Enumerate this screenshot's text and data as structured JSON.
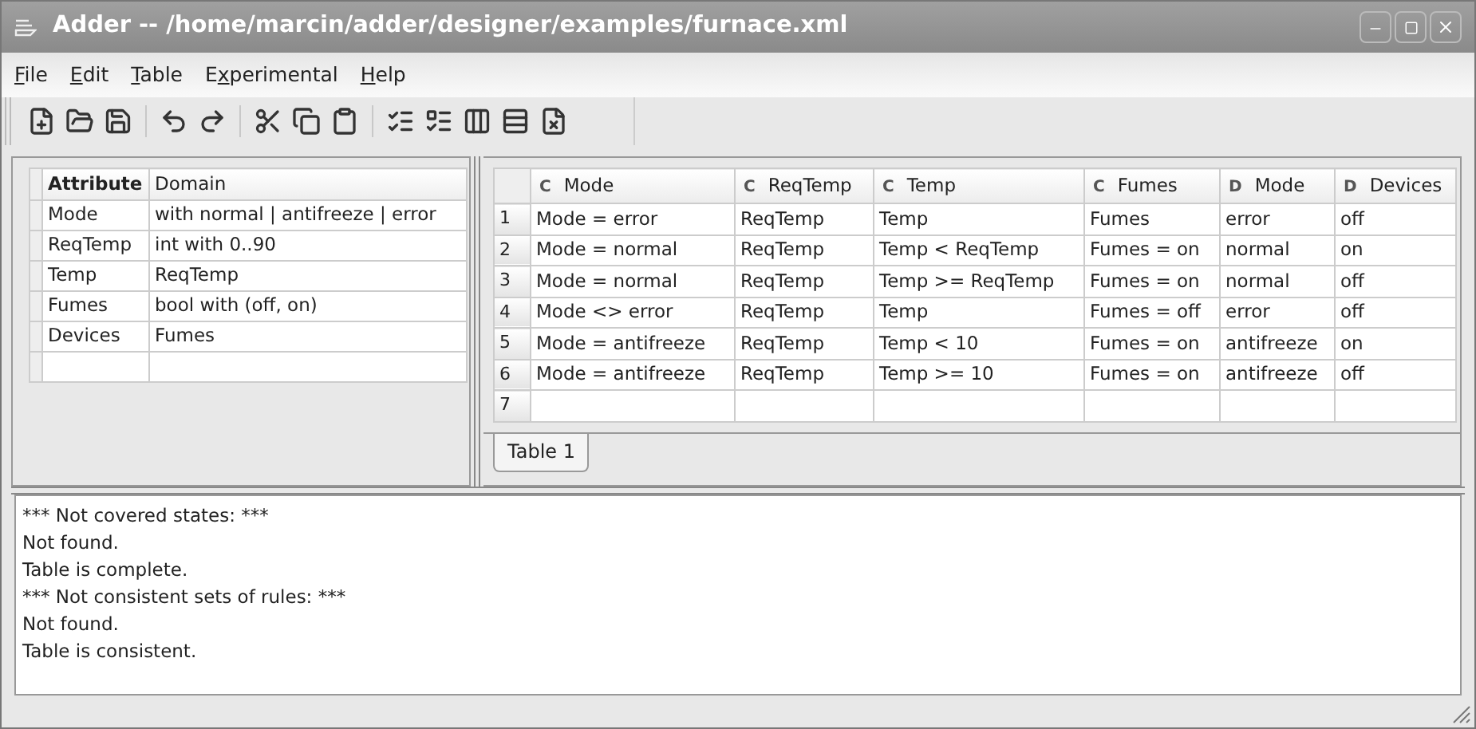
{
  "window": {
    "title": "Adder -- /home/marcin/adder/designer/examples/furnace.xml"
  },
  "menu": [
    {
      "key": "F",
      "post": "ile"
    },
    {
      "key": "E",
      "post": "dit"
    },
    {
      "key": "T",
      "post": "able"
    },
    {
      "pre": "E",
      "key": "x",
      "post": "perimental"
    },
    {
      "key": "H",
      "post": "elp"
    }
  ],
  "attributes": {
    "columns": [
      "Attribute",
      "Domain"
    ],
    "rows": [
      {
        "name": "Mode",
        "domain": "with normal | antifreeze | error"
      },
      {
        "name": "ReqTemp",
        "domain": "int with 0..90"
      },
      {
        "name": "Temp",
        "domain": "ReqTemp"
      },
      {
        "name": "Fumes",
        "domain": "bool with (off, on)"
      },
      {
        "name": "Devices",
        "domain": "Fumes"
      }
    ]
  },
  "rules": {
    "columns": [
      {
        "mark": "C",
        "label": "Mode"
      },
      {
        "mark": "C",
        "label": "ReqTemp"
      },
      {
        "mark": "C",
        "label": "Temp"
      },
      {
        "mark": "C",
        "label": "Fumes"
      },
      {
        "mark": "D",
        "label": "Mode"
      },
      {
        "mark": "D",
        "label": "Devices"
      }
    ],
    "rows": [
      {
        "number": "1",
        "cells": [
          "Mode = error",
          "ReqTemp",
          "Temp",
          "Fumes",
          "error",
          "off"
        ]
      },
      {
        "number": "2",
        "cells": [
          "Mode = normal",
          "ReqTemp",
          "Temp < ReqTemp",
          "Fumes = on",
          "normal",
          "on"
        ]
      },
      {
        "number": "3",
        "cells": [
          "Mode = normal",
          "ReqTemp",
          "Temp >= ReqTemp",
          "Fumes = on",
          "normal",
          "off"
        ]
      },
      {
        "number": "4",
        "cells": [
          "Mode <> error",
          "ReqTemp",
          "Temp",
          "Fumes = off",
          "error",
          "off"
        ]
      },
      {
        "number": "5",
        "cells": [
          "Mode = antifreeze",
          "ReqTemp",
          "Temp < 10",
          "Fumes = on",
          "antifreeze",
          "on"
        ]
      },
      {
        "number": "6",
        "cells": [
          "Mode = antifreeze",
          "ReqTemp",
          "Temp >= 10",
          "Fumes = on",
          "antifreeze",
          "off"
        ]
      },
      {
        "number": "7",
        "cells": [
          "",
          "",
          "",
          "",
          "",
          ""
        ]
      }
    ]
  },
  "tabs": [
    {
      "label": "Table 1",
      "selected": true
    }
  ],
  "log": [
    "*** Not covered states: ***",
    "Not found.",
    "Table is complete.",
    "*** Not consistent sets of rules: ***",
    "Not found.",
    "Table is consistent."
  ]
}
